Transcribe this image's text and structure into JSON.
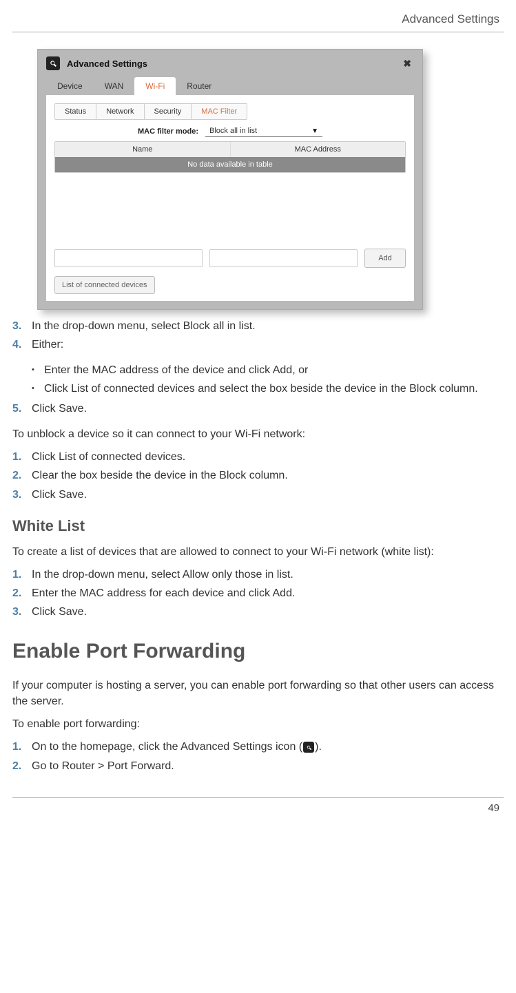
{
  "header": {
    "title": "Advanced Settings"
  },
  "screenshot": {
    "window_title": "Advanced Settings",
    "tabs": [
      "Device",
      "WAN",
      "Wi-Fi",
      "Router"
    ],
    "active_tab": "Wi-Fi",
    "subtabs": [
      "Status",
      "Network",
      "Security",
      "MAC Filter"
    ],
    "active_subtab": "MAC Filter",
    "filter_label": "MAC filter mode:",
    "filter_value": "Block all in list",
    "columns": [
      "Name",
      "MAC Address"
    ],
    "nodata_text": "No data available in table",
    "add_button": "Add",
    "list_button": "List of connected devices"
  },
  "steps_a": [
    {
      "n": "3.",
      "t": "In the drop-down menu, select Block all in list."
    },
    {
      "n": "4.",
      "t": "Either:"
    }
  ],
  "bullets_a": [
    "Enter the MAC address of the device and click Add, or",
    "Click List of connected devices and select the box beside the device in the Block column."
  ],
  "steps_a2": [
    {
      "n": "5.",
      "t": "Click Save."
    }
  ],
  "unblock_intro": "To unblock a device so it can connect to your Wi-Fi network:",
  "steps_b": [
    {
      "n": "1.",
      "t": "Click List of connected devices."
    },
    {
      "n": "2.",
      "t": "Clear the box beside the device in the Block column."
    },
    {
      "n": "3.",
      "t": "Click Save."
    }
  ],
  "whitelist": {
    "heading": "White List",
    "intro": "To create a list of devices that are allowed to connect to your Wi-Fi network (white list):",
    "steps": [
      {
        "n": "1.",
        "t": "In the drop-down menu, select Allow only those in list."
      },
      {
        "n": "2.",
        "t": "Enter the MAC address for each device and click Add."
      },
      {
        "n": "3.",
        "t": "Click Save."
      }
    ]
  },
  "portfwd": {
    "heading": "Enable Port Forwarding",
    "intro": "If your computer is hosting a server, you can enable port forwarding so that other users can access the server.",
    "intro2": "To enable port forwarding:",
    "step1_pre": "On to the homepage, click the Advanced Settings icon (",
    "step1_post": ").",
    "steps": [
      {
        "n": "2.",
        "t": "Go to Router > Port Forward."
      }
    ]
  },
  "page_number": "49"
}
